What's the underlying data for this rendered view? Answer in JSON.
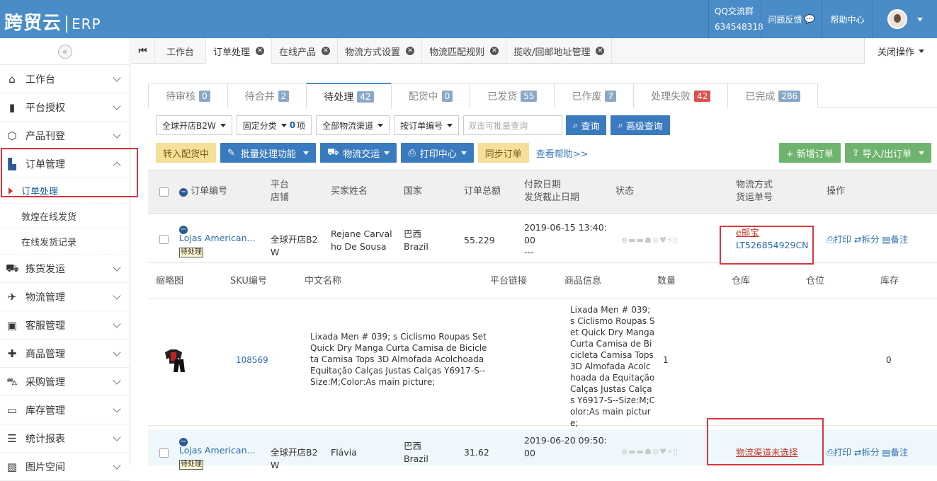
{
  "brand": {
    "logo": "跨贸云",
    "product": "ERP"
  },
  "topnav": {
    "qq_label": "QQ交流群",
    "qq_number": "634548318",
    "feedback": "问题反馈",
    "help": "帮助中心"
  },
  "sidebar": {
    "collapse_glyph": "«",
    "items": [
      {
        "label": "工作台",
        "icon": "home-icon"
      },
      {
        "label": "平台授权",
        "icon": "bookmark-icon"
      },
      {
        "label": "产品刊登",
        "icon": "cube-icon"
      },
      {
        "label": "订单管理",
        "icon": "file-icon"
      },
      {
        "label": "拣货发运",
        "icon": "truck-icon"
      },
      {
        "label": "物流管理",
        "icon": "plane-icon"
      },
      {
        "label": "客服管理",
        "icon": "briefcase-icon"
      },
      {
        "label": "商品管理",
        "icon": "gift-icon"
      },
      {
        "label": "采购管理",
        "icon": "cart-icon"
      },
      {
        "label": "库存管理",
        "icon": "inbox-icon"
      },
      {
        "label": "统计报表",
        "icon": "list-icon"
      },
      {
        "label": "图片空间",
        "icon": "image-icon"
      }
    ],
    "subitems": [
      "订单处理",
      "敦煌在线发货",
      "在线发货记录"
    ]
  },
  "tabs": [
    {
      "label": "工作台"
    },
    {
      "label": "订单处理"
    },
    {
      "label": "在线产品"
    },
    {
      "label": "物流方式设置"
    },
    {
      "label": "物流匹配规则"
    },
    {
      "label": "揽收/回邮地址管理"
    }
  ],
  "close_ops": "关闭操作",
  "status_tabs": [
    {
      "label": "待审核",
      "count": "0"
    },
    {
      "label": "待合并",
      "count": "2"
    },
    {
      "label": "待处理",
      "count": "42"
    },
    {
      "label": "配货中",
      "count": "0"
    },
    {
      "label": "已发货",
      "count": "55"
    },
    {
      "label": "已作废",
      "count": "7"
    },
    {
      "label": "处理失败",
      "count": "42"
    },
    {
      "label": "已完成",
      "count": "286"
    }
  ],
  "filters": {
    "store": "全球开店B2W",
    "category": "固定分类",
    "category_count": "0",
    "category_unit": "项",
    "channel": "全部物流渠道",
    "order_by": "按订单编号",
    "search_placeholder": "双击可批量查询",
    "query": "查询",
    "advanced": "高级查询"
  },
  "actions": {
    "to_picking": "转入配货中",
    "batch": "批量处理功能",
    "logistics": "物流交运",
    "print": "打印中心",
    "sync": "同步订单",
    "help_link": "查看帮助>>",
    "add_order": "+ 新增订单",
    "import_export": "导入/出订单"
  },
  "table_head": {
    "order_no": "订单编号",
    "platform": "平台",
    "store": "店铺",
    "buyer": "买家姓名",
    "country": "国家",
    "total": "订单总额",
    "pay_date": "付款日期",
    "ship_deadline": "发货截止日期",
    "status": "状态",
    "logistics": "物流方式",
    "tracking": "货运单号",
    "ops": "操作"
  },
  "orders": [
    {
      "order_no": "Lojas American...",
      "status_tag": "待处理",
      "store": "全球开店B2W",
      "buyer": "Rejane Carvalho De Sousa",
      "country_cn": "巴西",
      "country_en": "Brazil",
      "total": "55.229",
      "pay_date": "2019-06-15 13:40:00",
      "deadline": "---",
      "logistics": "e邮宝",
      "tracking": "LT526854929CN",
      "op_print": "打印",
      "op_split": "拆分",
      "op_note": "备注"
    },
    {
      "order_no": "Lojas American...",
      "status_tag": "待处理",
      "store": "全球开店B2W",
      "buyer": "Flávia",
      "country_cn": "巴西",
      "country_en": "Brazil",
      "total": "31.62",
      "pay_date": "2019-06-20 09:50:00",
      "logistics": "物流渠道未选择",
      "op_print": "打印",
      "op_split": "拆分",
      "op_note": "备注"
    }
  ],
  "detail_head": {
    "thumb": "缩略图",
    "sku": "SKU编号",
    "cn_name": "中文名称",
    "link": "平台链接",
    "info": "商品信息",
    "qty": "数量",
    "warehouse": "仓库",
    "location": "仓位",
    "stock": "库存"
  },
  "detail_row": {
    "sku": "108569",
    "cn_name": "Lixada Men # 039; s Ciclismo Roupas Set Quick Dry Manga Curta Camisa de Bicicleta Camisa Tops 3D Almofada Acolchoada Equitação Calças Justas Calças Y6917-S--Size:M;Color:As main picture;",
    "info": "Lixada Men # 039; s Ciclismo Roupas Set Quick Dry Manga Curta Camisa de Bicicleta Camisa Tops 3D Almofada Acolchoada da Equitação Calças Justas Calças Y6917-S--Size:M;Color:As main picture;",
    "qty": "1",
    "stock": "0"
  }
}
